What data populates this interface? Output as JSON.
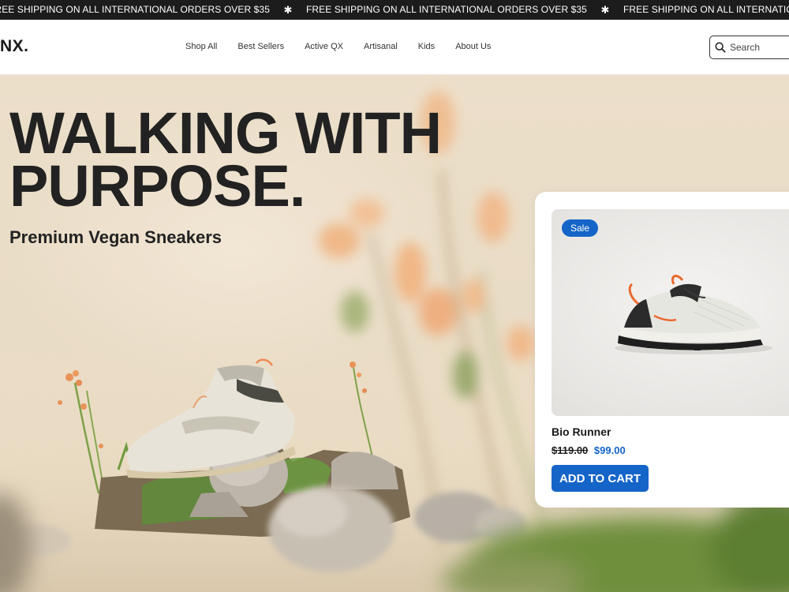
{
  "announcement": {
    "text": "FREE SHIPPING ON ALL INTERNATIONAL ORDERS OVER $35",
    "separator": "✱",
    "repeat": 4
  },
  "header": {
    "logo": "NX.",
    "nav": [
      "Shop All",
      "Best Sellers",
      "Active QX",
      "Artisanal",
      "Kids",
      "About Us"
    ],
    "search_placeholder": "Search",
    "search_icon": "search-icon"
  },
  "hero": {
    "headline": "WALKING WITH PURPOSE.",
    "subheadline": "Premium Vegan Sneakers"
  },
  "product_card": {
    "badge": "Sale",
    "name": "Bio Runner",
    "old_price": "$119.00",
    "new_price": "$99.00",
    "cta": "ADD TO CART"
  },
  "colors": {
    "accent": "#1565c8",
    "announcement_bg": "#1c1c1c",
    "hero_bg": "#eadcc5",
    "text": "#222222"
  }
}
